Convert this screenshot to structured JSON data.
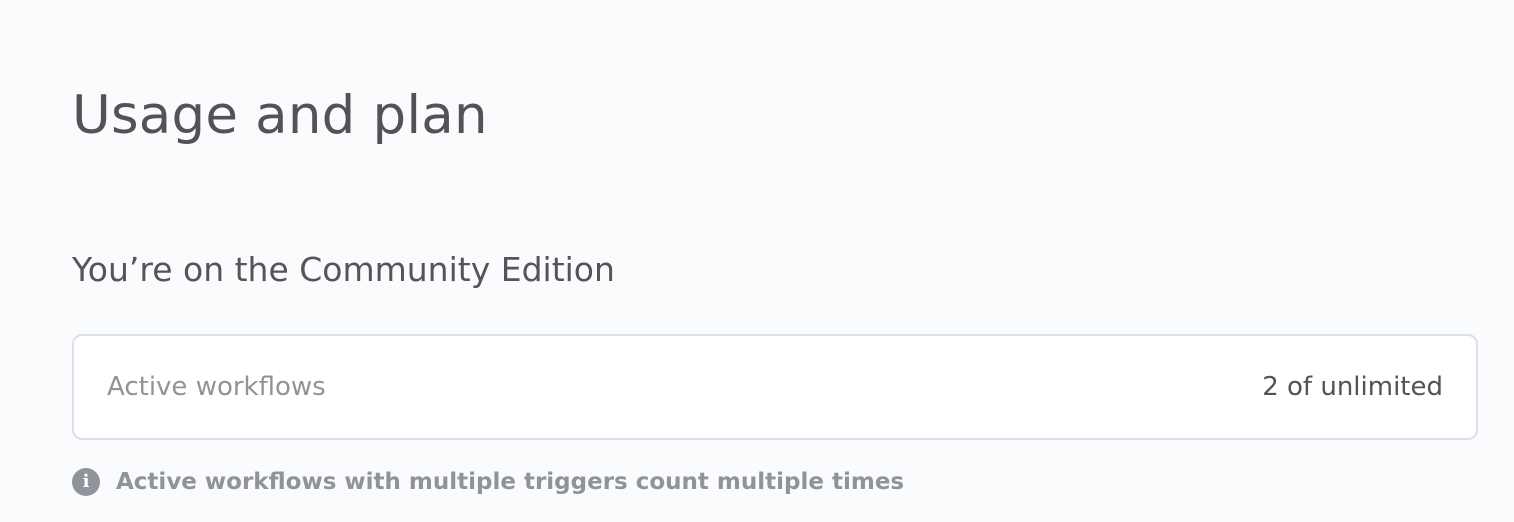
{
  "page": {
    "title": "Usage and plan"
  },
  "plan": {
    "heading": "You’re on the Community Edition"
  },
  "usage": {
    "label": "Active workflows",
    "value": "2 of unlimited"
  },
  "info": {
    "icon": "info-icon",
    "glyph": "i",
    "text": "Active workflows with multiple triggers count multiple times"
  },
  "colors": {
    "background": "#fafbfd",
    "card_border": "#dbdfe7",
    "muted_text": "#909399",
    "primary_text": "#525356"
  }
}
